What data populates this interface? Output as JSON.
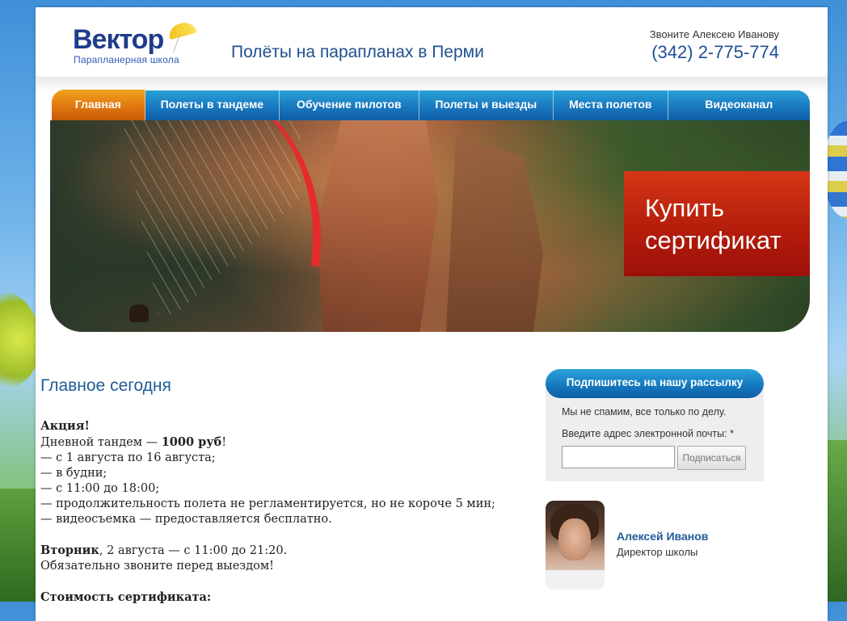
{
  "header": {
    "logo": {
      "name": "Вектор",
      "subtitle": "Парапланерная школа"
    },
    "tagline": "Полёты на парапланах в Перми",
    "contact_label": "Звоните Алексею Иванову",
    "phone": "(342) 2-775-774"
  },
  "nav": {
    "items": [
      {
        "label": "Главная",
        "active": true
      },
      {
        "label": "Полеты в тандеме",
        "active": false
      },
      {
        "label": "Обучение пилотов",
        "active": false
      },
      {
        "label": "Полеты и выезды",
        "active": false
      },
      {
        "label": "Места полетов",
        "active": false
      },
      {
        "label": "Видеоканал",
        "active": false
      }
    ]
  },
  "hero": {
    "cta_line1": "Купить",
    "cta_line2": "сертификат"
  },
  "main": {
    "title": "Главное сегодня",
    "promo_heading": "Акция!",
    "promo_line1_text": "Дневной тандем — ",
    "promo_line1_price": "1000 руб",
    "promo_line1_end": "!",
    "promo_items": [
      "— с 1 августа по 16 августа;",
      "— в будни;",
      "— с 11:00 до 18:00;",
      "— продолжительность полета не регламентируется, но не короче 5 мин;",
      "— видеосъемка — предоставляется бесплатно."
    ],
    "event_day": "Вторник",
    "event_rest": ", 2 августа — с 11:00 до 21:20.",
    "event_note": "Обязательно звоните перед выездом!",
    "cutoff_text": "Стоимость сертификата:"
  },
  "sidebar": {
    "subscribe_title": "Подпишитесь на нашу рассылку",
    "subscribe_note": "Мы не спамим, все только по делу.",
    "email_label": "Введите адрес электронной почты: *",
    "subscribe_button": "Подписаться",
    "person_name": "Алексей Иванов",
    "person_role": "Директор школы"
  },
  "colors": {
    "nav_blue": "#1a79bf",
    "nav_active": "#e07710",
    "cta_red": "#b51d0c",
    "link_blue": "#1f5c99"
  }
}
